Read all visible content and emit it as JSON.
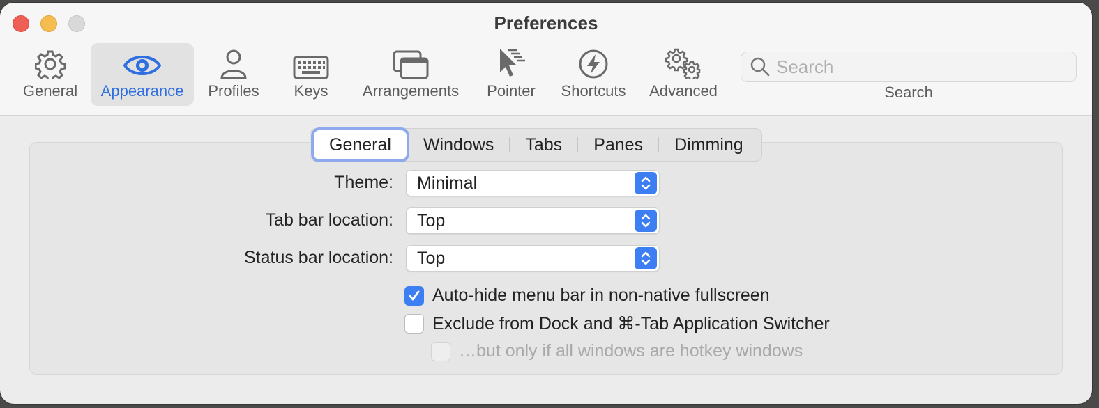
{
  "window": {
    "title": "Preferences"
  },
  "toolbar": {
    "items": [
      {
        "label": "General",
        "icon": "gear-icon"
      },
      {
        "label": "Appearance",
        "icon": "eye-icon",
        "selected": true
      },
      {
        "label": "Profiles",
        "icon": "person-icon"
      },
      {
        "label": "Keys",
        "icon": "keyboard-icon"
      },
      {
        "label": "Arrangements",
        "icon": "windows-icon"
      },
      {
        "label": "Pointer",
        "icon": "pointer-icon"
      },
      {
        "label": "Shortcuts",
        "icon": "bolt-icon"
      },
      {
        "label": "Advanced",
        "icon": "gears-icon"
      }
    ],
    "search": {
      "placeholder": "Search",
      "label": "Search"
    }
  },
  "tabs": {
    "items": [
      "General",
      "Windows",
      "Tabs",
      "Panes",
      "Dimming"
    ],
    "active": "General"
  },
  "form": {
    "theme": {
      "label": "Theme:",
      "value": "Minimal"
    },
    "tab_bar_location": {
      "label": "Tab bar location:",
      "value": "Top"
    },
    "status_bar_location": {
      "label": "Status bar location:",
      "value": "Top"
    }
  },
  "checkboxes": {
    "auto_hide": {
      "label": "Auto-hide menu bar in non-native fullscreen",
      "checked": true
    },
    "exclude_dock": {
      "label": "Exclude from Dock and ⌘-Tab Application Switcher",
      "checked": false
    },
    "hotkey_only": {
      "label": "…but only if all windows are hotkey windows",
      "checked": false,
      "disabled": true
    }
  },
  "colors": {
    "accent": "#3d7ff2",
    "selected_label": "#2f6fe0"
  }
}
